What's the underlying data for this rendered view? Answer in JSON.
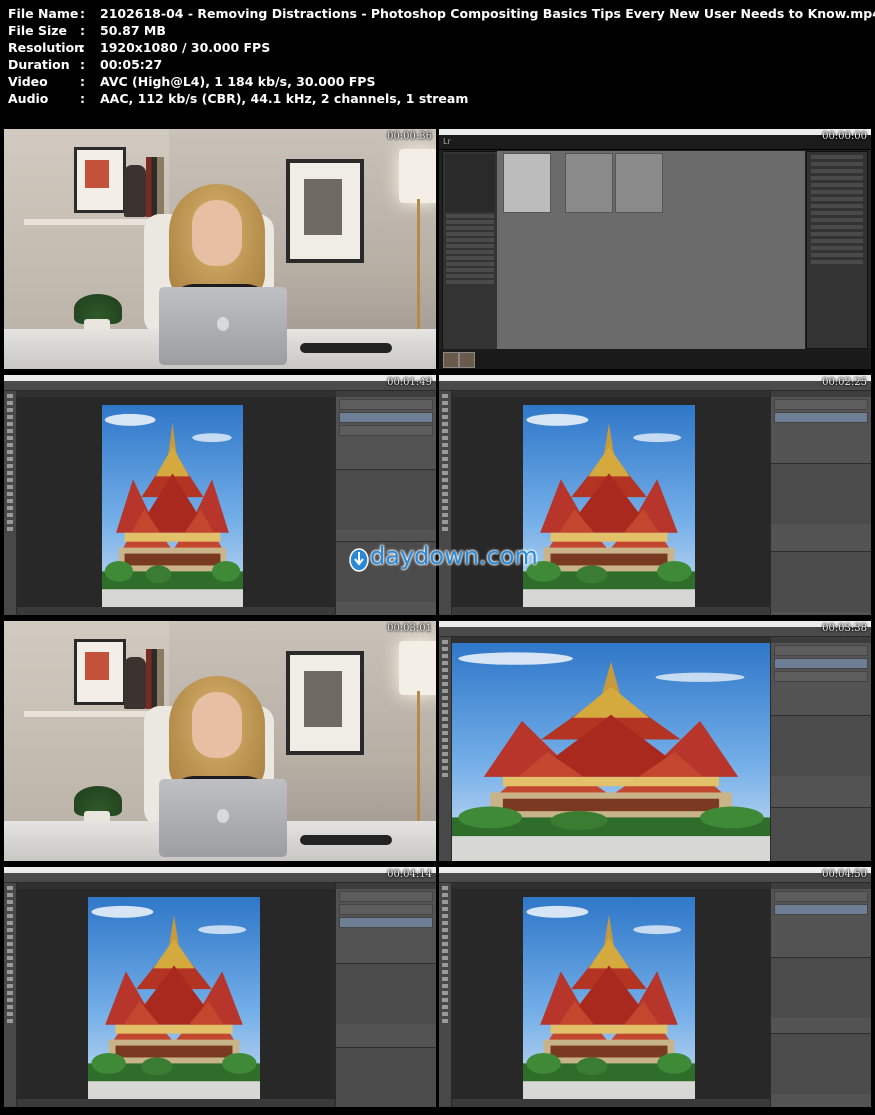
{
  "info": [
    {
      "key": "File Name",
      "value": "2102618-04 - Removing Distractions - Photoshop Compositing Basics Tips Every New User Needs to Know.mp4"
    },
    {
      "key": "File Size",
      "value": "50.87 MB"
    },
    {
      "key": "Resolution",
      "value": "1920x1080 / 30.000 FPS"
    },
    {
      "key": "Duration",
      "value": "00:05:27"
    },
    {
      "key": "Video",
      "value": "AVC (High@L4), 1 184 kb/s, 30.000 FPS"
    },
    {
      "key": "Audio",
      "value": "AAC, 112 kb/s (CBR), 44.1 kHz, 2 channels, 1 stream"
    }
  ],
  "separator": ":",
  "thumbnails": [
    {
      "timestamp": "00:00:36",
      "scene": "studio"
    },
    {
      "timestamp": "00:00:00",
      "scene": "lightroom"
    },
    {
      "timestamp": "00:01:49",
      "scene": "photoshop"
    },
    {
      "timestamp": "00:02:25",
      "scene": "photoshop"
    },
    {
      "timestamp": "00:03:01",
      "scene": "studio"
    },
    {
      "timestamp": "00:03:38",
      "scene": "photoshop-zoom"
    },
    {
      "timestamp": "00:04:14",
      "scene": "photoshop"
    },
    {
      "timestamp": "00:04:50",
      "scene": "photoshop"
    }
  ],
  "watermark": {
    "text": "daydown.com",
    "icon": "download-icon",
    "color": "#2a88d8"
  }
}
